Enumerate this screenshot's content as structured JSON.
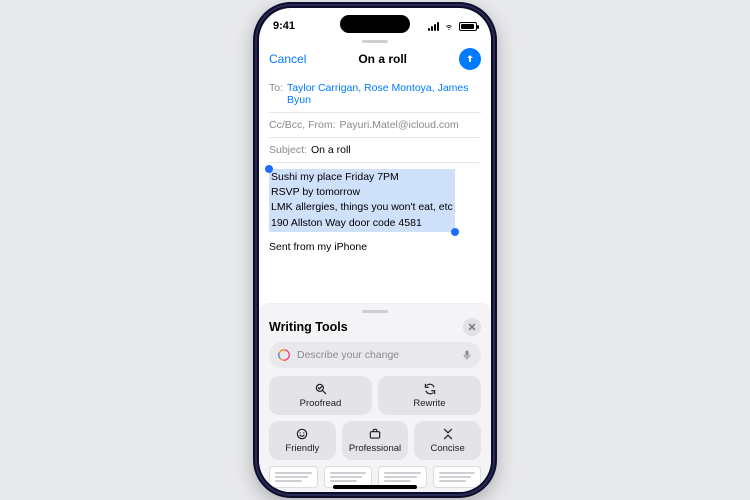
{
  "status": {
    "time": "9:41"
  },
  "compose": {
    "cancel": "Cancel",
    "title": "On a roll",
    "to_label": "To:",
    "to_value": "Taylor Carrigan, Rose Montoya, James Byun",
    "ccfrom_label": "Cc/Bcc, From:",
    "ccfrom_value": "Payuri.Matel@icloud.com",
    "subject_label": "Subject:",
    "subject_value": "On a roll",
    "body_selected": "Sushi my place Friday 7PM\nRSVP by tomorrow\nLMK allergies, things you won't eat, etc\n190 Allston Way door code 4581",
    "signature": "Sent from my iPhone"
  },
  "wt": {
    "title": "Writing Tools",
    "placeholder": "Describe your change",
    "actions": {
      "proofread": "Proofread",
      "rewrite": "Rewrite",
      "friendly": "Friendly",
      "professional": "Professional",
      "concise": "Concise"
    }
  }
}
